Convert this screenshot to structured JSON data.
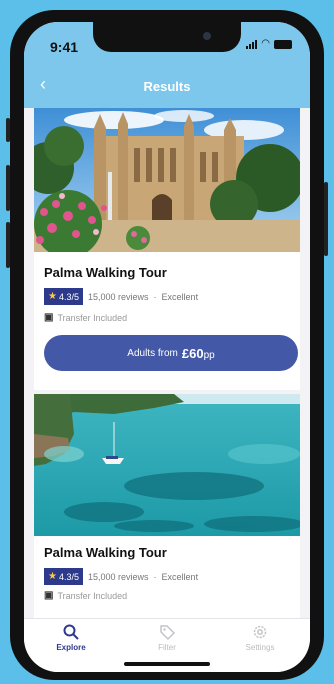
{
  "status": {
    "time": "9:41"
  },
  "nav": {
    "title": "Results",
    "back_icon": "chevron-left-icon"
  },
  "results": [
    {
      "title": "Palma Walking Tour",
      "rating": "4.3/5",
      "reviews": "15,000 reviews",
      "separator": "·",
      "rating_text": "Excellent",
      "transfer": "Transfer Included",
      "cta_prefix": "Adults from",
      "cta_price": "£60",
      "cta_suffix": "pp"
    },
    {
      "title": "Palma Walking Tour",
      "rating": "4.3/5",
      "reviews": "15,000 reviews",
      "separator": "·",
      "rating_text": "Excellent",
      "transfer": "Transfer Included"
    }
  ],
  "tabs": [
    {
      "label": "Explore",
      "icon": "search-icon",
      "active": true
    },
    {
      "label": "Filter",
      "icon": "tag-icon",
      "active": false
    },
    {
      "label": "Settings",
      "icon": "gear-icon",
      "active": false
    }
  ],
  "colors": {
    "sky": "#5bbfe9",
    "header": "#7ec7ec",
    "primary": "#4359a8",
    "badge": "#2d3a8c",
    "star": "#ffc83d"
  }
}
